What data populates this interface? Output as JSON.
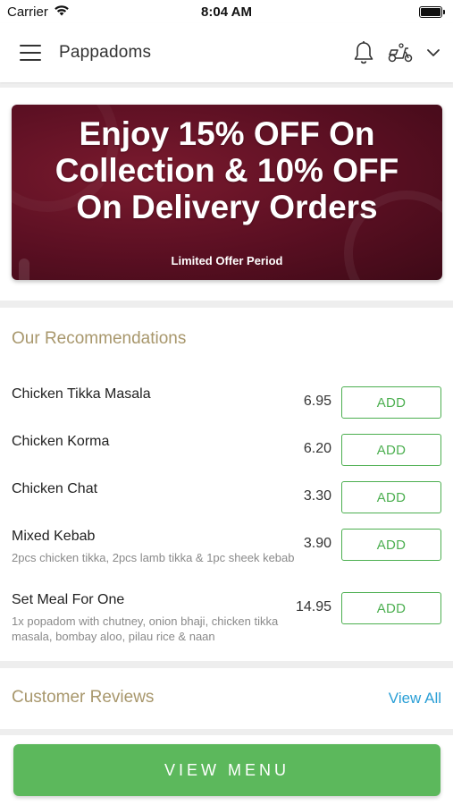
{
  "status_bar": {
    "carrier": "Carrier",
    "time": "8:04 AM"
  },
  "header": {
    "title": "Pappadoms",
    "icons": [
      "menu-icon",
      "bell-icon",
      "scooter-icon",
      "chevron-down-icon"
    ]
  },
  "banner": {
    "headline_line1": "Enjoy 15% OFF On",
    "headline_line2": "Collection & 10% OFF",
    "headline_line3": "On Delivery Orders",
    "subtext": "Limited Offer Period",
    "background_color": "#5a0f22"
  },
  "recommendations": {
    "title": "Our Recommendations",
    "add_label": "ADD",
    "items": [
      {
        "name": "Chicken Tikka Masala",
        "price": "6.95",
        "description": ""
      },
      {
        "name": "Chicken Korma",
        "price": "6.20",
        "description": ""
      },
      {
        "name": "Chicken Chat",
        "price": "3.30",
        "description": ""
      },
      {
        "name": "Mixed Kebab",
        "price": "3.90",
        "description": "2pcs chicken tikka, 2pcs lamb tikka & 1pc sheek kebab"
      },
      {
        "name": "Set Meal For One",
        "price": "14.95",
        "description": "1x popadom with chutney, onion bhaji, chicken tikka masala, bombay aloo, pilau rice & naan"
      }
    ]
  },
  "reviews": {
    "title": "Customer Reviews",
    "view_all": "View All"
  },
  "footer": {
    "view_menu": "VIEW MENU"
  },
  "colors": {
    "accent_green": "#5cb85c",
    "section_title": "#a8976c",
    "link_blue": "#2a9fd6"
  }
}
